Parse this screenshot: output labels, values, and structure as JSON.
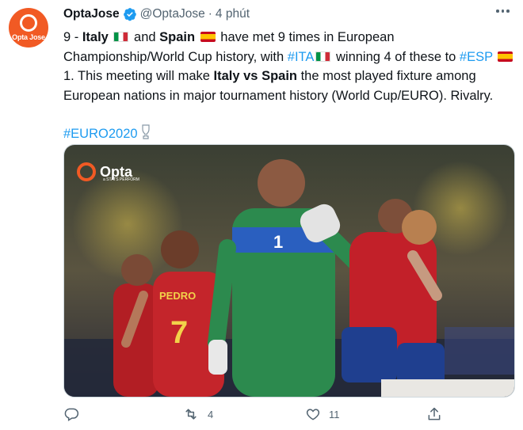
{
  "tweet": {
    "author_name": "OptaJose",
    "handle": "@OptaJose",
    "separator": "·",
    "time": "4 phút",
    "avatar_text": "Opta Jose",
    "body": {
      "line1_prefix": "9 - ",
      "italy": "Italy",
      "and": " and ",
      "spain": "Spain",
      "line1_rest": " have met 9 times in European Championship/World Cup history, with ",
      "tag_ita": "#ITA",
      "winning": " winning 4 of these to ",
      "tag_esp": "#ESP",
      "one": " 1. This meeting will make ",
      "italy_vs_spain": "Italy vs Spain",
      "rest": " the most played fixture among European nations in major tournament history (World Cup/EURO). Rivalry.",
      "hashtag": "#EURO2020"
    },
    "media": {
      "logo_text": "Opta",
      "logo_sub": "a STATS PERFORM",
      "jersey_name": "PEDRO",
      "jersey_number": "7",
      "keeper_number": "1"
    },
    "actions": {
      "reply_count": "",
      "retweet_count": "4",
      "like_count": "11"
    },
    "colors": {
      "link": "#1d9bf0",
      "brand": "#f15a24",
      "muted": "#536471"
    }
  }
}
